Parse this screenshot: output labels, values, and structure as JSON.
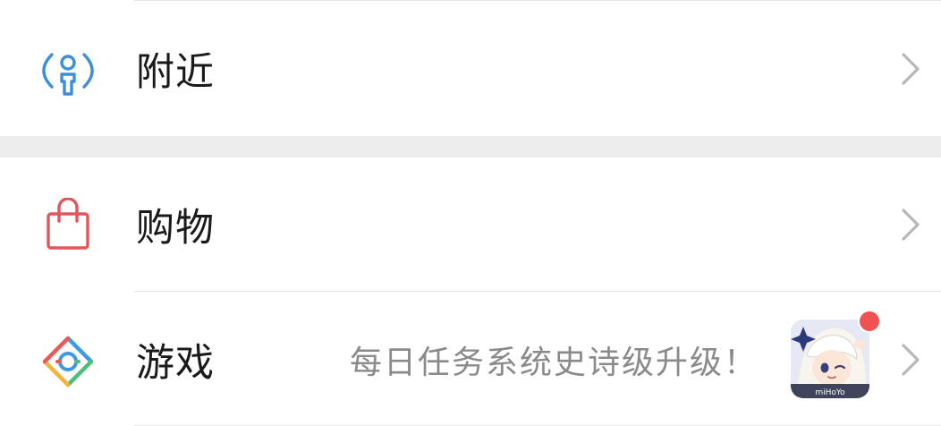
{
  "menu": {
    "nearby": {
      "label": "附近",
      "icon": "nearby-person-icon",
      "icon_color": "#3f8fd6"
    },
    "shopping": {
      "label": "购物",
      "icon": "shopping-bag-icon",
      "icon_color": "#e0565b"
    },
    "games": {
      "label": "游戏",
      "icon": "games-diamond-icon",
      "promo_text": "每日任务系统史诗级升级！",
      "thumbnail": "game-character-thumbnail",
      "thumbnail_caption": "miHoYo",
      "badge_color": "#f05153"
    }
  },
  "chevron_icon": "chevron-right-icon"
}
